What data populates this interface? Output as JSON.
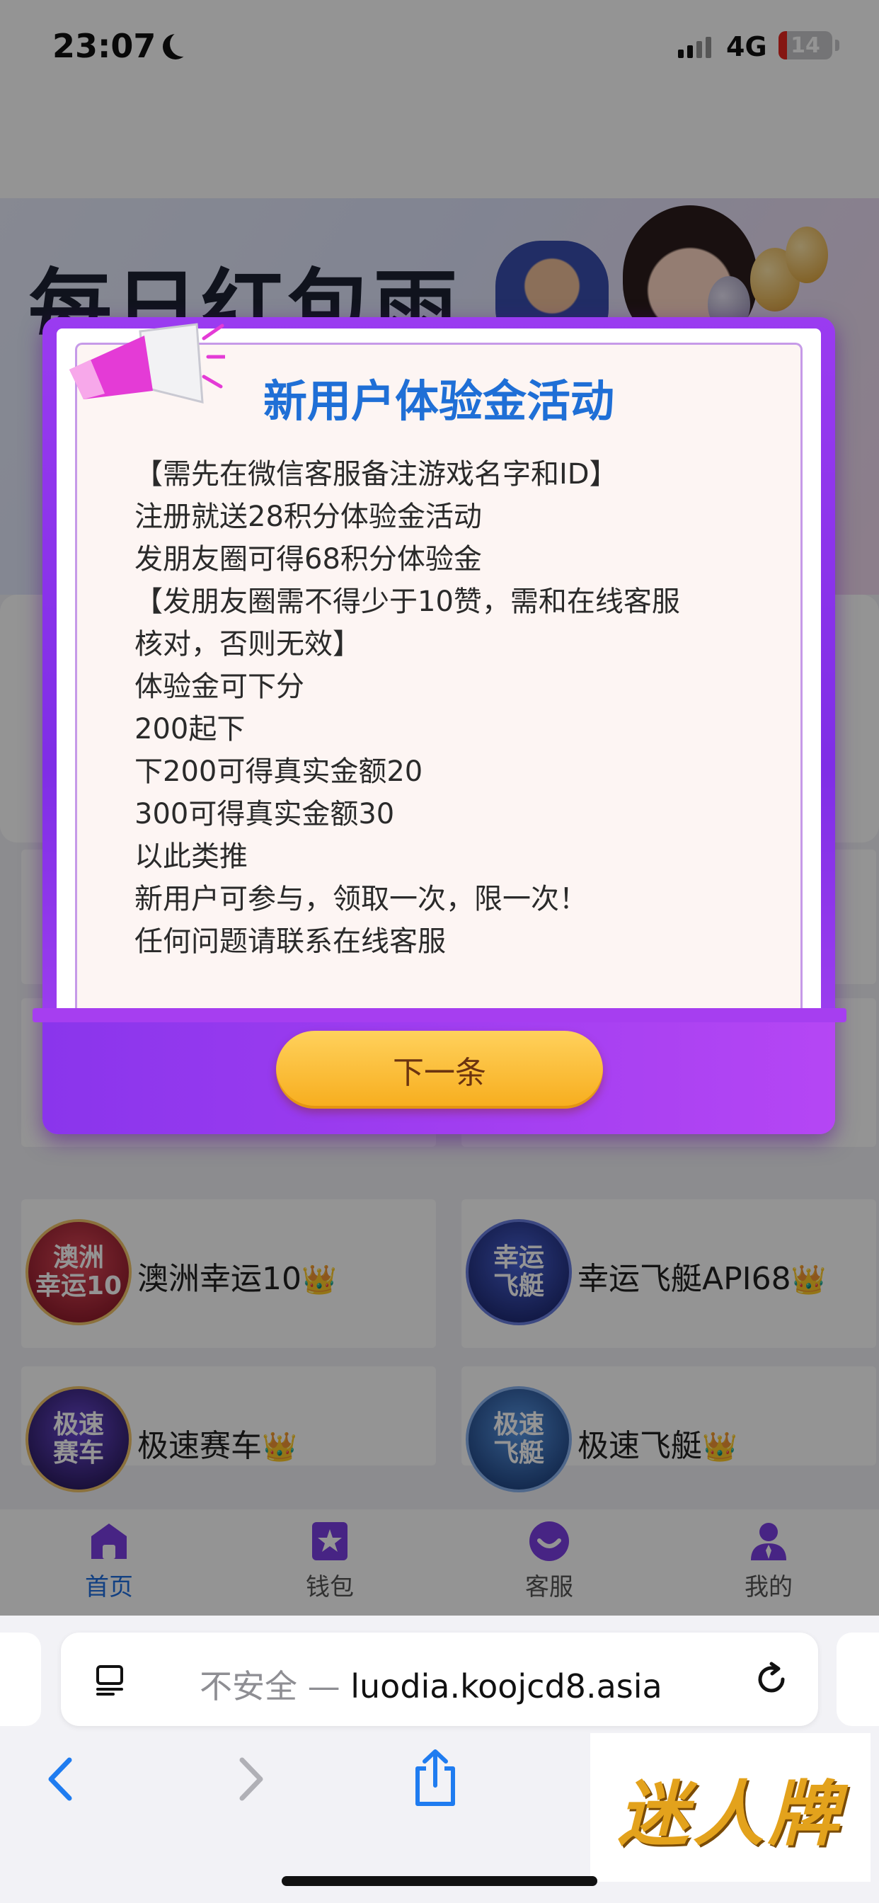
{
  "status_bar": {
    "time": "23:07",
    "network": "4G",
    "battery": "14"
  },
  "banner": {
    "title": "每日红包雨"
  },
  "modal": {
    "title": "新用户体验金活动",
    "lines": [
      "【需先在微信客服备注游戏名字和ID】",
      "注册就送28积分体验金活动",
      "发朋友圈可得68积分体验金",
      "【发朋友圈需不得少于10赞，需和在线客服",
      "核对，否则无效】",
      "体验金可下分",
      "200起下",
      "下200可得真实金额20",
      "300可得真实金额30",
      "以此类推",
      "新用户可参与，领取一次，限一次！",
      "任何问题请联系在线客服"
    ],
    "next_button": "下一条"
  },
  "games": [
    {
      "name": "澳洲幸运10",
      "crown": "👑",
      "icon_text": "澳洲\n幸运10",
      "icon_color": "#c22a3a"
    },
    {
      "name": "幸运飞艇API68",
      "crown": "👑",
      "icon_text": "幸运\n飞艇",
      "icon_color": "#2a3f9c"
    },
    {
      "name": "极速赛车",
      "crown": "👑",
      "icon_text": "极速\n赛车",
      "icon_color": "#3b2a7a"
    },
    {
      "name": "极速飞艇",
      "crown": "👑",
      "icon_text": "极速\n飞艇",
      "icon_color": "#2a5fb0"
    }
  ],
  "tabbar": {
    "items": [
      {
        "label": "首页",
        "icon": "home-icon",
        "active": true
      },
      {
        "label": "钱包",
        "icon": "wallet-star-icon",
        "active": false
      },
      {
        "label": "客服",
        "icon": "customer-service-icon",
        "active": false
      },
      {
        "label": "我的",
        "icon": "profile-icon",
        "active": false
      }
    ]
  },
  "browser": {
    "insecure_label": "不安全 — ",
    "host": "luodia.koojcd8.asia"
  },
  "watermark": {
    "text": "迷人牌"
  },
  "colors": {
    "accent": "#1f6fe0",
    "modal_purple": "#9a3bf0",
    "button_orange": "#f7ad1d",
    "title_blue": "#1f6fd6"
  }
}
